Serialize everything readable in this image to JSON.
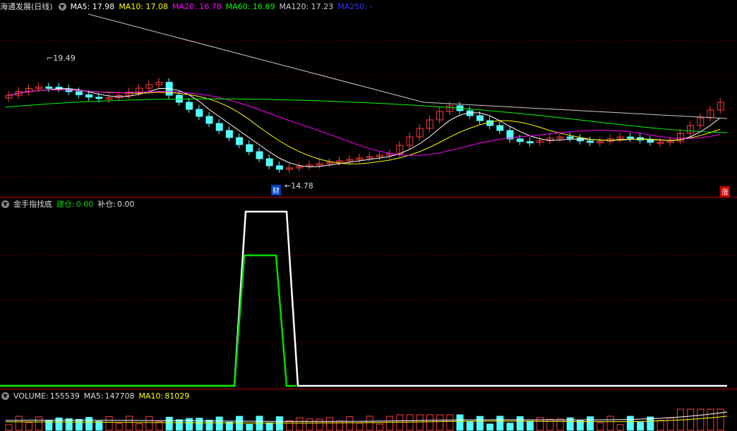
{
  "main": {
    "title": "海通发展(日线)",
    "ma": [
      {
        "label": "MA5:",
        "value": "17.98",
        "color": "#ffffff"
      },
      {
        "label": "MA10:",
        "value": "17.08",
        "color": "#ffff00"
      },
      {
        "label": "MA20:",
        "value": "16.78",
        "color": "#ff00ff"
      },
      {
        "label": "MA60:",
        "value": "16.69",
        "color": "#00ff00"
      },
      {
        "label": "MA120:",
        "value": "17.23",
        "color": "#cccccc"
      },
      {
        "label": "MA250:",
        "value": "-",
        "color": "#3333ff"
      }
    ],
    "high_label": "19.49",
    "low_label": "14.78",
    "cai_badge": "财",
    "zhang_badge": "涨"
  },
  "indicator": {
    "title": "金手指找底",
    "jiancang_label": "建仓:",
    "jiancang_value": "0.00",
    "bucang_label": "补仓:",
    "bucang_value": "0.00"
  },
  "volume": {
    "title": "VOLUME:",
    "value": "155539",
    "ma5_label": "MA5:",
    "ma5_value": "147708",
    "ma10_label": "MA10:",
    "ma10_value": "81029"
  },
  "colors": {
    "up": "#ff3b3b",
    "down": "#54ffff",
    "ma5": "#ffffff",
    "ma10": "#ffff00",
    "ma20": "#ff00ff",
    "ma60": "#00ff00",
    "ma120": "#cccccc",
    "buy_line": "#00dd00",
    "grid": "#8b0000"
  }
}
